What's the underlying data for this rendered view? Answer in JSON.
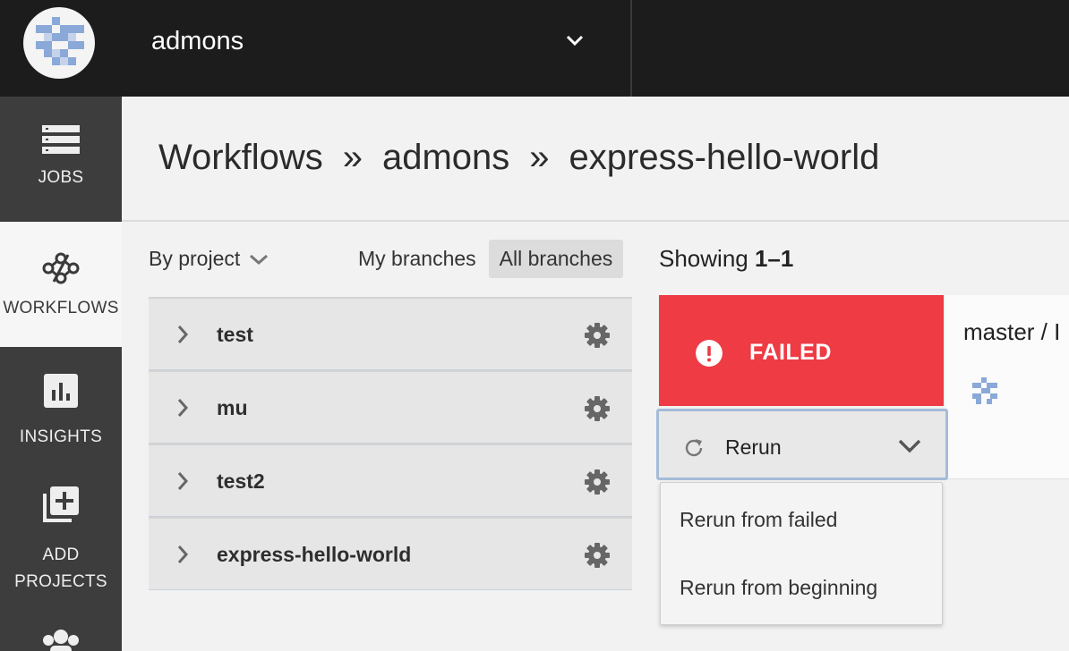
{
  "org": {
    "name": "admons"
  },
  "sidebar": {
    "items": [
      {
        "label": "JOBS"
      },
      {
        "label": "WORKFLOWS"
      },
      {
        "label": "INSIGHTS"
      },
      {
        "label_line1": "ADD",
        "label_line2": "PROJECTS"
      }
    ]
  },
  "breadcrumb": {
    "root": "Workflows",
    "sep": "»",
    "org": "admons",
    "project": "express-hello-world"
  },
  "filters": {
    "group_by": "By project",
    "my_branches": "My branches",
    "all_branches": "All branches"
  },
  "projects": [
    {
      "name": "test"
    },
    {
      "name": "mu"
    },
    {
      "name": "test2"
    },
    {
      "name": "express-hello-world"
    }
  ],
  "results": {
    "showing_prefix": "Showing",
    "showing_range": "1–1"
  },
  "workflow": {
    "status": "FAILED",
    "branch": "master / I"
  },
  "rerun": {
    "label": "Rerun",
    "options": [
      "Rerun from failed",
      "Rerun from beginning"
    ]
  },
  "colors": {
    "failed": "#ee3b44",
    "accent_border": "#a5bcd9",
    "logo_blue": "#8aa8d8"
  }
}
